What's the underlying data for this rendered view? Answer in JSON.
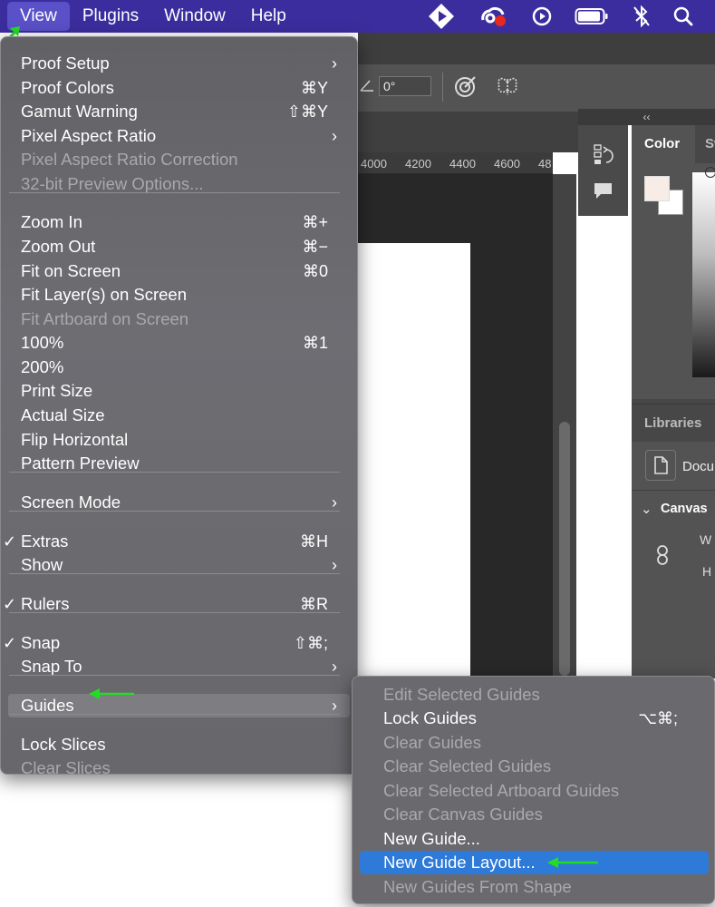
{
  "menubar": {
    "items": [
      "View",
      "Plugins",
      "Window",
      "Help"
    ],
    "status_icons": [
      "stage-manager-icon",
      "creative-cloud-icon",
      "play-circle-icon",
      "battery-icon",
      "bluetooth-icon",
      "search-icon"
    ]
  },
  "options_bar": {
    "angle_value": "0°"
  },
  "ruler": {
    "ticks": [
      "4000",
      "4200",
      "4400",
      "4600",
      "48"
    ]
  },
  "panels": {
    "color_tab": "Color",
    "swatches_tab": "Sw",
    "libraries_tab": "Libraries",
    "libraries_item": "Docu",
    "canvas_section": "Canvas",
    "width_label": "W",
    "height_label": "H"
  },
  "view_menu": {
    "items": [
      {
        "label": "Proof Setup",
        "shortcut": "",
        "submenu": true,
        "enabled": true,
        "checked": false
      },
      {
        "label": "Proof Colors",
        "shortcut": "⌘Y",
        "submenu": false,
        "enabled": true,
        "checked": false
      },
      {
        "label": "Gamut Warning",
        "shortcut": "⇧⌘Y",
        "submenu": false,
        "enabled": true,
        "checked": false
      },
      {
        "label": "Pixel Aspect Ratio",
        "shortcut": "",
        "submenu": true,
        "enabled": true,
        "checked": false
      },
      {
        "label": "Pixel Aspect Ratio Correction",
        "shortcut": "",
        "submenu": false,
        "enabled": false,
        "checked": false
      },
      {
        "label": "32-bit Preview Options...",
        "shortcut": "",
        "submenu": false,
        "enabled": false,
        "checked": false
      },
      {
        "label": "Zoom In",
        "shortcut": "⌘+",
        "submenu": false,
        "enabled": true,
        "checked": false
      },
      {
        "label": "Zoom Out",
        "shortcut": "⌘−",
        "submenu": false,
        "enabled": true,
        "checked": false
      },
      {
        "label": "Fit on Screen",
        "shortcut": "⌘0",
        "submenu": false,
        "enabled": true,
        "checked": false
      },
      {
        "label": "Fit Layer(s) on Screen",
        "shortcut": "",
        "submenu": false,
        "enabled": true,
        "checked": false
      },
      {
        "label": "Fit Artboard on Screen",
        "shortcut": "",
        "submenu": false,
        "enabled": false,
        "checked": false
      },
      {
        "label": "100%",
        "shortcut": "⌘1",
        "submenu": false,
        "enabled": true,
        "checked": false
      },
      {
        "label": "200%",
        "shortcut": "",
        "submenu": false,
        "enabled": true,
        "checked": false
      },
      {
        "label": "Print Size",
        "shortcut": "",
        "submenu": false,
        "enabled": true,
        "checked": false
      },
      {
        "label": "Actual Size",
        "shortcut": "",
        "submenu": false,
        "enabled": true,
        "checked": false
      },
      {
        "label": "Flip Horizontal",
        "shortcut": "",
        "submenu": false,
        "enabled": true,
        "checked": false
      },
      {
        "label": "Pattern Preview",
        "shortcut": "",
        "submenu": false,
        "enabled": true,
        "checked": false
      },
      {
        "label": "Screen Mode",
        "shortcut": "",
        "submenu": true,
        "enabled": true,
        "checked": false
      },
      {
        "label": "Extras",
        "shortcut": "⌘H",
        "submenu": false,
        "enabled": true,
        "checked": true
      },
      {
        "label": "Show",
        "shortcut": "",
        "submenu": true,
        "enabled": true,
        "checked": false
      },
      {
        "label": "Rulers",
        "shortcut": "⌘R",
        "submenu": false,
        "enabled": true,
        "checked": true
      },
      {
        "label": "Snap",
        "shortcut": "⇧⌘;",
        "submenu": false,
        "enabled": true,
        "checked": true
      },
      {
        "label": "Snap To",
        "shortcut": "",
        "submenu": true,
        "enabled": true,
        "checked": false
      },
      {
        "label": "Guides",
        "shortcut": "",
        "submenu": true,
        "enabled": true,
        "checked": false
      },
      {
        "label": "Lock Slices",
        "shortcut": "",
        "submenu": false,
        "enabled": true,
        "checked": false
      },
      {
        "label": "Clear Slices",
        "shortcut": "",
        "submenu": false,
        "enabled": false,
        "checked": false
      }
    ]
  },
  "guides_submenu": {
    "items": [
      {
        "label": "Edit Selected Guides",
        "shortcut": "",
        "enabled": false
      },
      {
        "label": "Lock Guides",
        "shortcut": "⌥⌘;",
        "enabled": true
      },
      {
        "label": "Clear Guides",
        "shortcut": "",
        "enabled": false
      },
      {
        "label": "Clear Selected Guides",
        "shortcut": "",
        "enabled": false
      },
      {
        "label": "Clear Selected Artboard Guides",
        "shortcut": "",
        "enabled": false
      },
      {
        "label": "Clear Canvas Guides",
        "shortcut": "",
        "enabled": false
      },
      {
        "label": "New Guide...",
        "shortcut": "",
        "enabled": true
      },
      {
        "label": "New Guide Layout...",
        "shortcut": "",
        "enabled": true
      },
      {
        "label": "New Guides From Shape",
        "shortcut": "",
        "enabled": false
      }
    ]
  },
  "colors": {
    "menubar_bg": "#3c2d9e",
    "selection_blue": "#2e7ad8",
    "annotation_arrow": "#22dd22"
  }
}
